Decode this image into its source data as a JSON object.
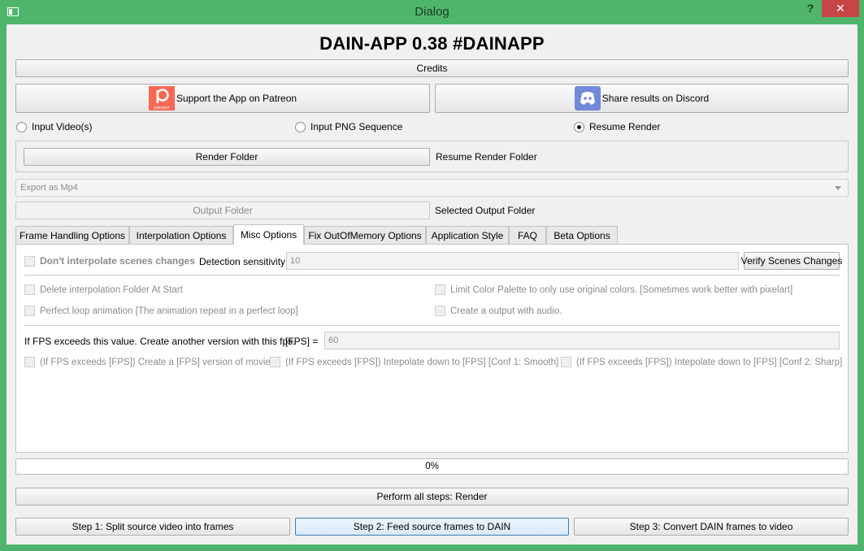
{
  "window": {
    "title": "Dialog",
    "help": "?",
    "close": "✕"
  },
  "app": {
    "heading": "DAIN-APP 0.38 #DAINAPP",
    "credits": "Credits",
    "patreon": "Support the App on Patreon",
    "patreon_logo_text": "patreon",
    "discord": "Share results on Discord"
  },
  "input_mode": {
    "options": [
      {
        "label": "Input Video(s)",
        "checked": false
      },
      {
        "label": "Input PNG Sequence",
        "checked": false
      },
      {
        "label": "Resume Render",
        "checked": true
      }
    ]
  },
  "resume": {
    "render_folder_button": "Render Folder",
    "render_folder_label": "Resume Render Folder"
  },
  "export": {
    "selected": "Export as Mp4",
    "output_folder_button": "Output Folder",
    "output_folder_label": "Selected Output Folder"
  },
  "tabs": [
    {
      "label": "Frame Handling Options",
      "active": false
    },
    {
      "label": "Interpolation Options",
      "active": false
    },
    {
      "label": "Misc Options",
      "active": true
    },
    {
      "label": "Fix OutOfMemory Options",
      "active": false
    },
    {
      "label": "Application Style",
      "active": false
    },
    {
      "label": "FAQ",
      "active": false
    },
    {
      "label": "Beta Options",
      "active": false
    }
  ],
  "misc": {
    "scene_change_checkbox": "Don't interpolate scenes changes",
    "detection_label": "Detection sensitivity:",
    "detection_value": "10",
    "verify_button": "Verify Scenes Changes",
    "delete_folder": "Delete interpolation Folder At Start",
    "limit_palette": "Limit Color Palette to only use original colors. [Sometimes work better with pixelart]",
    "perfect_loop": "Perfect loop animation [The animation repeat in a perfect loop]",
    "audio_output": "Create a output with audio.",
    "fps_label": "If FPS exceeds this value. Create another version with this fps.",
    "fps_eq_label": "[FPS] =",
    "fps_value": "60",
    "fps_opt1": "(If FPS exceeds [FPS]) Create a [FPS] version of movie.",
    "fps_opt2": "(If FPS exceeds [FPS]) Intepolate down to  [FPS] [Conf 1: Smooth]",
    "fps_opt3": "(If FPS exceeds [FPS]) Intepolate down to  [FPS] [Conf 2: Sharp]"
  },
  "progress": {
    "value": 0,
    "text": "0%"
  },
  "actions": {
    "perform_all": "Perform all steps: Render",
    "step1": "Step 1: Split source video into frames",
    "step2": "Step 2: Feed source frames to DAIN",
    "step3": "Step 3: Convert DAIN frames to video"
  }
}
